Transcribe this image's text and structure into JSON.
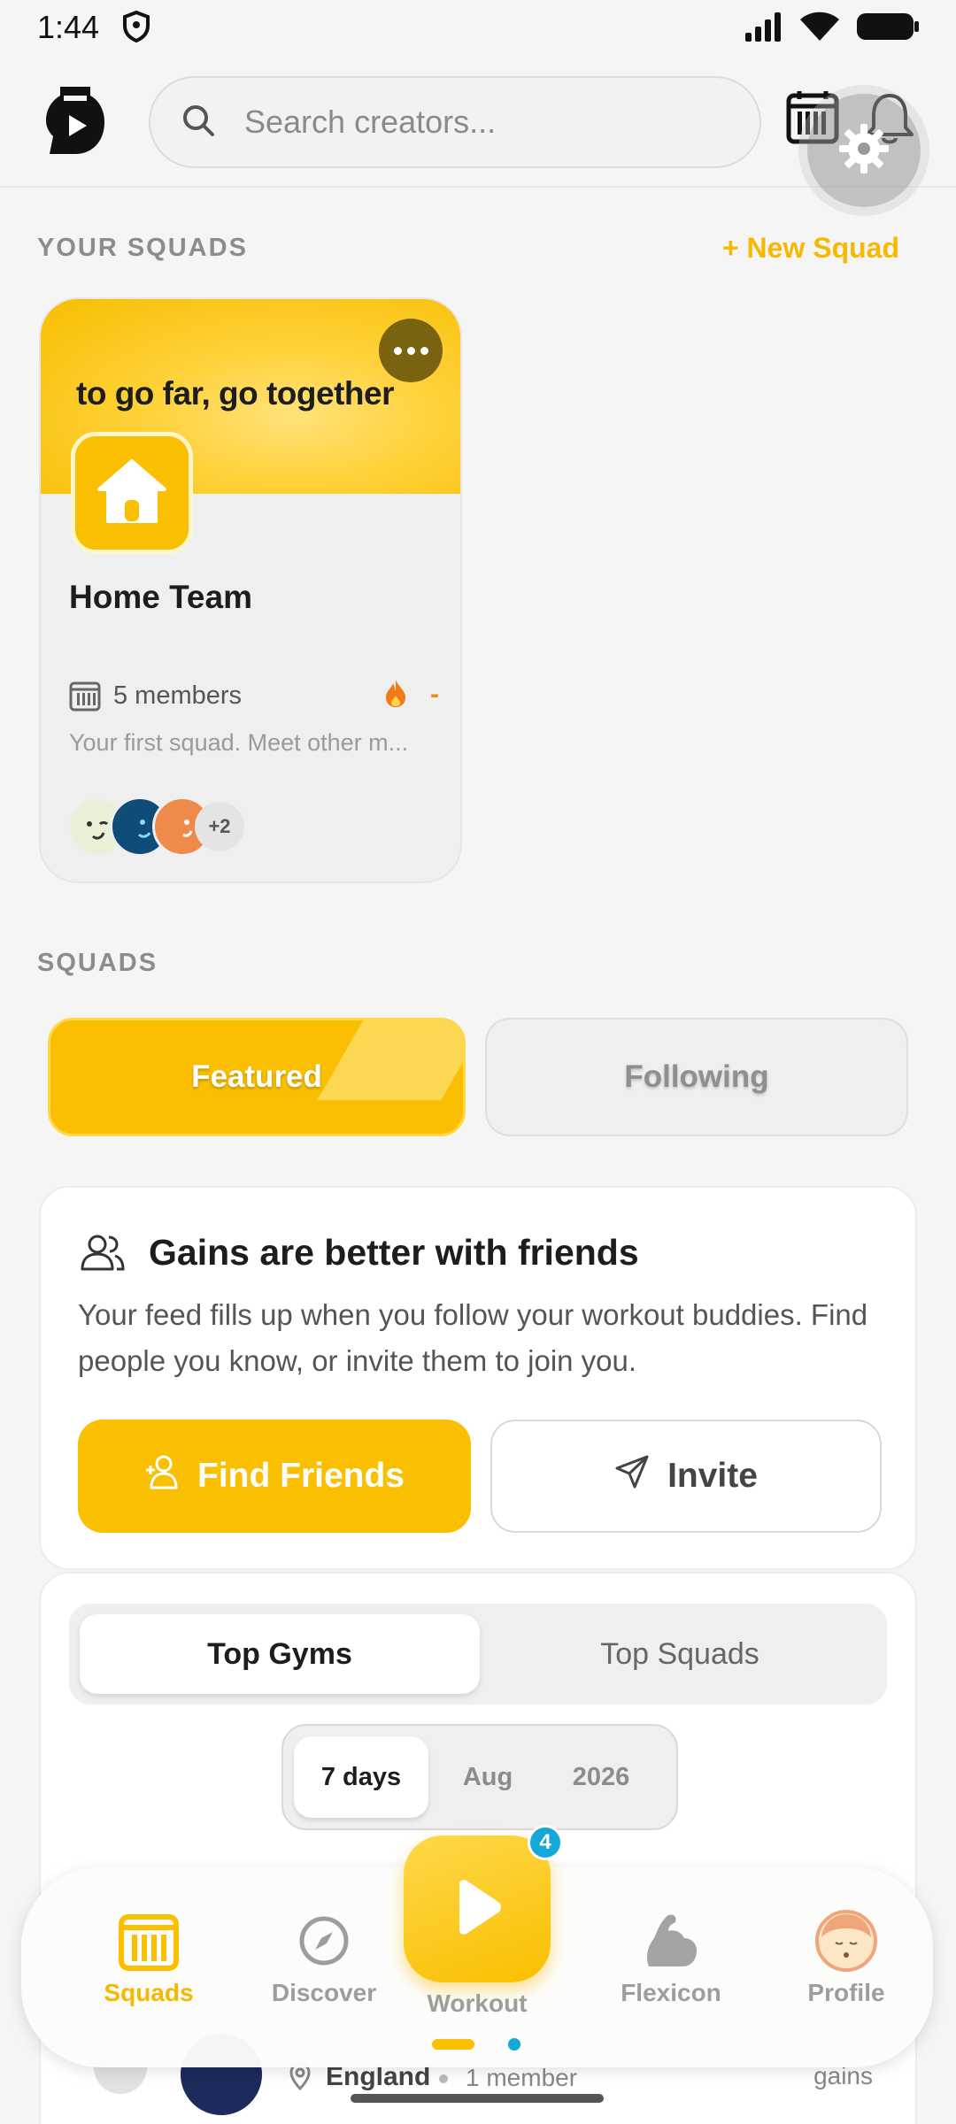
{
  "status_bar": {
    "time": "1:44"
  },
  "search": {
    "placeholder": "Search creators..."
  },
  "your_squads": {
    "heading": "YOUR SQUADS",
    "new_squad_label": "+ New Squad",
    "card": {
      "banner_text": "to go far, go together",
      "name": "Home Team",
      "members": "5 members",
      "streak": "-",
      "description": "Your first squad. Meet other m...",
      "more_count": "+2"
    }
  },
  "squads": {
    "heading": "SQUADS",
    "tab_featured": "Featured",
    "tab_following": "Following"
  },
  "friends_card": {
    "title": "Gains are better with friends",
    "body": "Your feed fills up when you follow your workout buddies. Find people you know, or invite them to join you.",
    "find_friends_label": "Find Friends",
    "invite_label": "Invite"
  },
  "leaderboard": {
    "tab_gyms": "Top Gyms",
    "tab_squads": "Top Squads",
    "period_7days": "7 days",
    "period_month": "Aug",
    "period_year": "2026",
    "row": {
      "location": "England",
      "members": "1 member",
      "metric": "gains"
    }
  },
  "bottom_nav": {
    "squads": "Squads",
    "discover": "Discover",
    "workout": "Workout",
    "workout_badge": "4",
    "flexicon": "Flexicon",
    "profile": "Profile"
  },
  "colors": {
    "accent": "#f9bf00",
    "badge": "#12a8d8"
  }
}
